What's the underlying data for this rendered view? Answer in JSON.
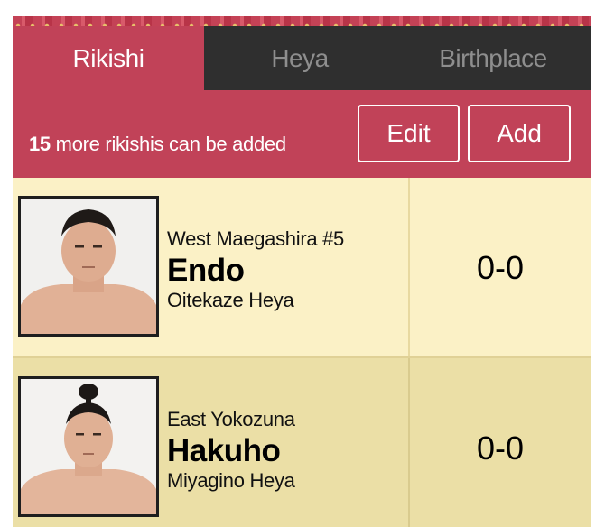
{
  "tabs": [
    {
      "label": "Rikishi",
      "active": true
    },
    {
      "label": "Heya",
      "active": false
    },
    {
      "label": "Birthplace",
      "active": false
    }
  ],
  "toolbar": {
    "count": "15",
    "message": " more rikishis can be added",
    "edit_label": "Edit",
    "add_label": "Add"
  },
  "rikishi": [
    {
      "rank": "West Maegashira #5",
      "name": "Endo",
      "heya": "Oitekaze Heya",
      "record": "0-0"
    },
    {
      "rank": "East Yokozuna",
      "name": "Hakuho",
      "heya": "Miyagino Heya",
      "record": "0-0"
    }
  ],
  "colors": {
    "accent": "#c14258",
    "tab_inactive": "#2f2f2f",
    "row_light": "#fbf1c6",
    "row_dark": "#ebdfa6"
  }
}
